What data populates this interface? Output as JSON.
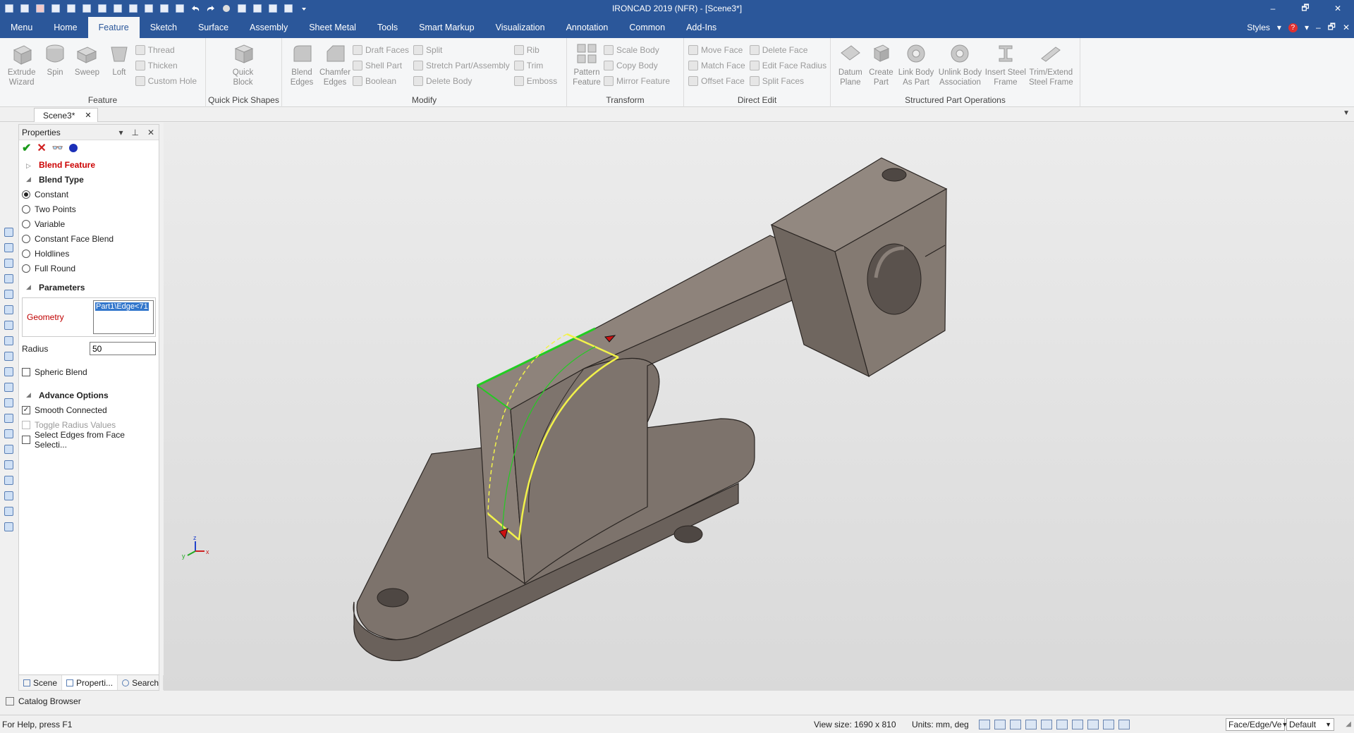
{
  "window": {
    "title": "IRONCAD 2019 (NFR) - [Scene3*]",
    "controls": [
      "–",
      "🗗",
      "✕"
    ]
  },
  "ribbon_tabs": [
    "Menu",
    "Home",
    "Feature",
    "Sketch",
    "Surface",
    "Assembly",
    "Sheet Metal",
    "Tools",
    "Smart Markup",
    "Visualization",
    "Annotation",
    "Common",
    "Add-Ins"
  ],
  "active_tab": "Feature",
  "ribbon_right": {
    "styles": "Styles"
  },
  "groups": {
    "feature": {
      "label": "Feature",
      "extrude": "Extrude Wizard",
      "spin": "Spin",
      "sweep": "Sweep",
      "loft": "Loft",
      "thread": "Thread",
      "thicken": "Thicken",
      "custom_hole": "Custom Hole"
    },
    "quick_pick": {
      "label": "Quick Pick Shapes",
      "quick_block": "Quick Block"
    },
    "modify": {
      "label": "Modify",
      "blend_edges": "Blend Edges",
      "chamfer_edges": "Chamfer Edges",
      "draft_faces": "Draft Faces",
      "shell_part": "Shell Part",
      "boolean": "Boolean",
      "split": "Split",
      "stretch": "Stretch Part/Assembly",
      "delete_body": "Delete Body",
      "rib": "Rib",
      "trim": "Trim",
      "emboss": "Emboss"
    },
    "transform": {
      "label": "Transform",
      "pattern_feature": "Pattern Feature",
      "scale_body": "Scale Body",
      "copy_body": "Copy Body",
      "mirror_feature": "Mirror Feature"
    },
    "direct_edit": {
      "label": "Direct Edit",
      "move_face": "Move Face",
      "match_face": "Match Face",
      "offset_face": "Offset Face",
      "delete_face": "Delete Face",
      "edit_face_radius": "Edit Face Radius",
      "split_faces": "Split Faces"
    },
    "structured": {
      "label": "Structured Part Operations",
      "datum_plane": "Datum Plane",
      "create_part": "Create Part",
      "link_body": "Link Body As Part",
      "unlink_body": "Unlink Body Association",
      "insert_steel": "Insert Steel Frame",
      "trim_extend": "Trim/Extend Steel Frame"
    }
  },
  "doc_tab": {
    "name": "Scene3*",
    "close": "✕"
  },
  "properties": {
    "header": "Properties",
    "blend_feature": "Blend Feature",
    "blend_type": "Blend Type",
    "types": [
      "Constant",
      "Two Points",
      "Variable",
      "Constant Face Blend",
      "Holdlines",
      "Full Round"
    ],
    "selected_type": "Constant",
    "parameters": "Parameters",
    "geometry_label": "Geometry",
    "geometry_value": "Part1\\Edge<71",
    "radius_label": "Radius",
    "radius_value": "50",
    "spheric_blend": "Spheric Blend",
    "advance_options": "Advance Options",
    "smooth_connected": "Smooth Connected",
    "toggle_radius": "Toggle Radius Values",
    "select_edges": "Select Edges from Face Selecti...",
    "bottom_tabs": [
      "Scene",
      "Properti...",
      "Search"
    ]
  },
  "catalog_browser": "Catalog Browser",
  "status": {
    "help": "For Help, press F1",
    "view_size": "View size: 1690 x  810",
    "units": "Units: mm, deg",
    "selection_filter": "Face/Edge/Ve",
    "style": "Default"
  },
  "colors": {
    "accent": "#2b579a",
    "part": "#857a72",
    "highlight": "#f2f24a",
    "selected_edge": "#22cc22",
    "required": "#cc0000"
  }
}
